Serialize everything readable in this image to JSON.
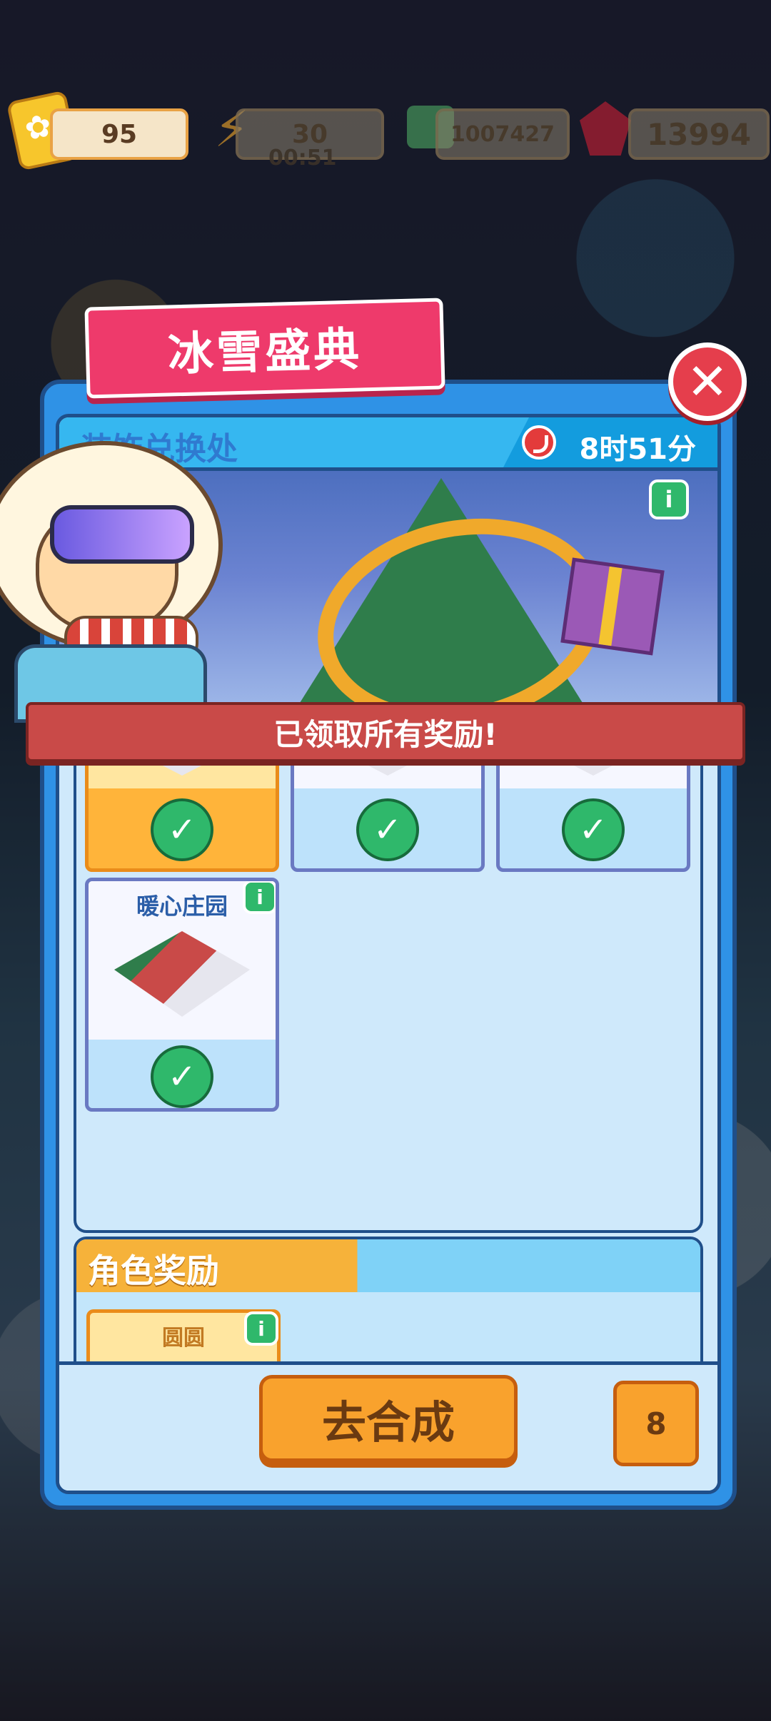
{
  "resources": {
    "tickets": "95",
    "energy": "30",
    "energy_timer": "00:51",
    "coins": "1007427",
    "gems": "13994"
  },
  "event": {
    "title": "冰雪盛典"
  },
  "panel": {
    "subheader_title": "装饰兑换处",
    "timer": "8时51分",
    "claimed_message": "已领取所有奖励!"
  },
  "decor_rewards": {
    "cards": [
      {
        "name": "",
        "claimed": true,
        "highlighted": true
      },
      {
        "name": "",
        "claimed": true,
        "highlighted": false
      },
      {
        "name": "",
        "claimed": true,
        "highlighted": false
      },
      {
        "name": "暖心庄园",
        "claimed": true,
        "highlighted": false
      }
    ]
  },
  "role_rewards": {
    "title": "角色奖励",
    "cards": [
      {
        "name": "圆圆"
      }
    ]
  },
  "bottom": {
    "go_button": "去合成",
    "trophy_count": "8"
  },
  "icons": {
    "info": "i",
    "close": "✕",
    "check": "✓"
  },
  "colors": {
    "accent_pink": "#ee3a6b",
    "panel_blue": "#2f92e6",
    "gold": "#f9a22d",
    "green": "#2fb86b"
  }
}
